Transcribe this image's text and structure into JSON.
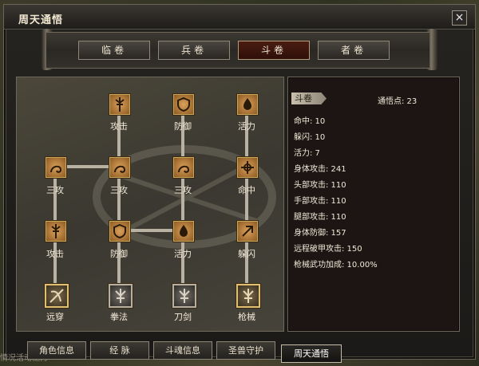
{
  "window": {
    "title": "周天通悟",
    "close": "×"
  },
  "tabs": [
    "临卷",
    "兵卷",
    "斗卷",
    "者卷"
  ],
  "active_tab": 2,
  "tree": {
    "row1": [
      "攻击",
      "防御",
      "活力"
    ],
    "row2": [
      "三攻",
      "三攻",
      "三攻",
      "命中"
    ],
    "row3": [
      "攻击",
      "防御",
      "活力",
      "躲闪"
    ],
    "row4": [
      "远穿",
      "拳法",
      "刀剑",
      "枪械"
    ]
  },
  "stats": {
    "tag": "斗卷",
    "points": "通悟点: 23",
    "lines": [
      "命中: 10",
      "躲闪: 10",
      "活力: 7",
      "身体攻击: 241",
      "头部攻击: 110",
      "手部攻击: 110",
      "腿部攻击: 110",
      "身体防御: 157",
      "远程破甲攻击: 150",
      "枪械武功加成: 10.00%"
    ]
  },
  "bottom_tabs": [
    "角色信息",
    "经 脉",
    "斗魂信息",
    "圣兽守护",
    "周天通悟"
  ],
  "ghost_text": "情况活动能力"
}
